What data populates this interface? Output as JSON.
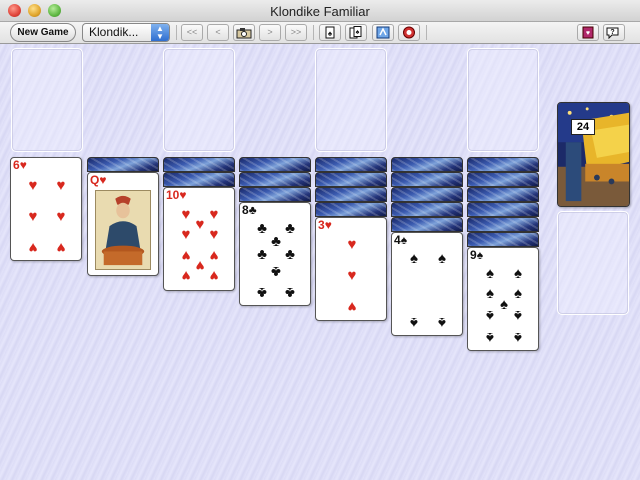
{
  "window": {
    "title": "Klondike Familiar"
  },
  "toolbar": {
    "new_game_label": "New Game",
    "game_select_value": "Klondik...",
    "nav_first": "<<",
    "nav_prev": "<",
    "nav_next": ">",
    "nav_last": ">>",
    "icons": [
      "camera-icon",
      "autoplay-icon",
      "autoplay-all-icon",
      "deal-settings-icon",
      "help-lifebuoy-icon",
      "card-back-icon",
      "help-icon"
    ]
  },
  "stock": {
    "count": "24"
  },
  "tableau": [
    {
      "face_down": 0,
      "card": {
        "rank": "6",
        "suit": "♥",
        "color": "red"
      }
    },
    {
      "face_down": 1,
      "card": {
        "rank": "Q",
        "suit": "♥",
        "color": "red"
      }
    },
    {
      "face_down": 2,
      "card": {
        "rank": "10",
        "suit": "♥",
        "color": "red"
      }
    },
    {
      "face_down": 3,
      "card": {
        "rank": "8",
        "suit": "♣",
        "color": "black"
      }
    },
    {
      "face_down": 4,
      "card": {
        "rank": "3",
        "suit": "♥",
        "color": "red"
      }
    },
    {
      "face_down": 5,
      "card": {
        "rank": "4",
        "suit": "♠",
        "color": "black"
      }
    },
    {
      "face_down": 6,
      "card": {
        "rank": "9",
        "suit": "♠",
        "color": "black"
      }
    }
  ],
  "colors": {
    "red_suit": "#d8281e",
    "table_bg": "#e0e0f8"
  }
}
